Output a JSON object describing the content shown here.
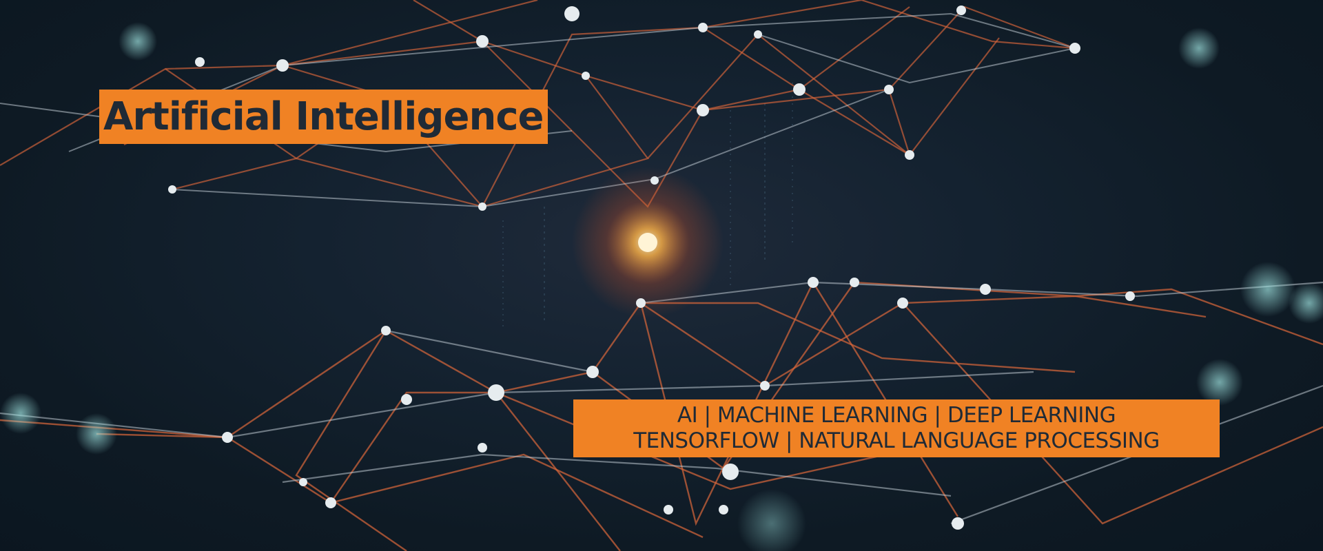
{
  "banner": {
    "title": "Artificial Intelligence",
    "tagline_line1": "AI | MACHINE LEARNING | DEEP LEARNING",
    "tagline_line2": "TENSORFLOW | NATURAL LANGUAGE PROCESSING"
  },
  "colors": {
    "accent": "#f08224",
    "text": "#1f2a36",
    "background": "#0f1c26",
    "network_orange": "#d9663a",
    "network_light": "#c9d3dc",
    "node_cyan": "#8fd6d6"
  },
  "background_image": "network-nodes-image"
}
